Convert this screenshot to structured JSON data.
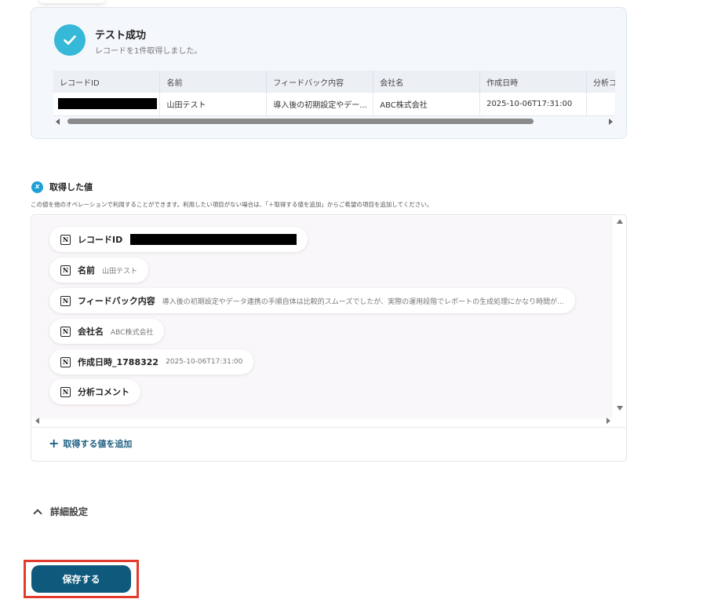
{
  "test_result": {
    "title": "テスト成功",
    "subtitle": "レコードを1件取得しました。",
    "table": {
      "columns": [
        "レコードID",
        "名前",
        "フィードバック内容",
        "会社名",
        "作成日時",
        "分析コ"
      ],
      "row": [
        "",
        "山田テスト",
        "導入後の初期設定やデー...",
        "ABC株式会社",
        "2025-10-06T17:31:00",
        ""
      ]
    }
  },
  "acquired_values": {
    "title": "取得した値",
    "icon_label": "x",
    "description": "この値を他のオペレーションで利用することができます。利用したい項目がない場合は、「＋取得する値を追加」からご希望の項目を追加してください。",
    "items": [
      {
        "label": "レコードID",
        "value": ""
      },
      {
        "label": "名前",
        "value": "山田テスト"
      },
      {
        "label": "フィードバック内容",
        "value": "導入後の初期設定やデータ連携の手順自体は比較的スムーズでしたが、実際の運用段階でレポートの生成処理にかなり時間が..."
      },
      {
        "label": "会社名",
        "value": "ABC株式会社"
      },
      {
        "label": "作成日時_1788322",
        "value": "2025-10-06T17:31:00"
      },
      {
        "label": "分析コメント",
        "value": ""
      }
    ],
    "add_label": "取得する値を追加",
    "add_plus": "+"
  },
  "detail_settings": {
    "label": "詳細設定"
  },
  "save": {
    "label": "保存する"
  },
  "icons": {
    "notion": "N"
  },
  "colors": {
    "accent": "#0f5a7c",
    "success": "#36b8d9",
    "highlight": "#e23b2e"
  }
}
